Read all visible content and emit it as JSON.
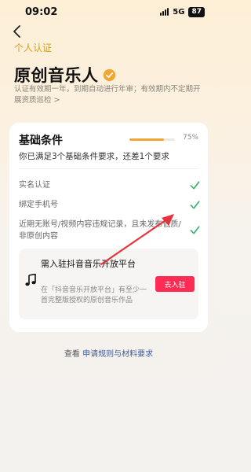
{
  "status_bar": {
    "time": "09:02",
    "network": "5G",
    "battery": "87"
  },
  "header": {
    "subtitle": "个人认证",
    "title": "原创音乐人",
    "icon": "verified-check-icon"
  },
  "description": "认证有效期一年，到期自动进行年审；有效期内不定期开展资质巡检 >",
  "card": {
    "title": "基础条件",
    "progress_value": 0.75,
    "progress_text": "75%",
    "subtitle": "你已满足3个基础条件要求，还差1个要求",
    "conditions": [
      {
        "label": "实名认证",
        "met": true
      },
      {
        "label": "绑定手机号",
        "met": true
      },
      {
        "label": "近期无账号/视频内容违规记录，且未发布低质/非原创内容",
        "met": true
      }
    ],
    "platform": {
      "icon": "music-note-icon",
      "title": "需入驻抖音音乐开放平台",
      "desc": "在「抖音音乐开放平台」有至少一首完整版授权的原创音乐作品",
      "button": "去入驻"
    }
  },
  "footer": {
    "prefix": "查看",
    "link": "申请规则与材料要求"
  },
  "colors": {
    "accent": "#f1a532",
    "button": "#fe2c55",
    "check": "#3cb371",
    "link": "#3a5d9c",
    "arrow": "#e8323a"
  }
}
